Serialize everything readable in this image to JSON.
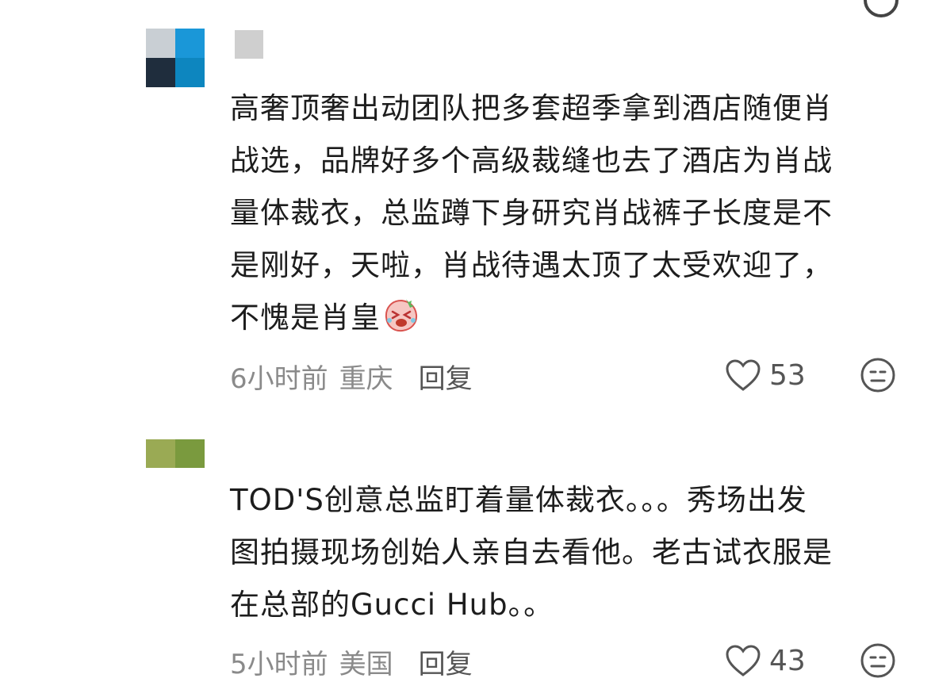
{
  "comments": [
    {
      "text_lines": [
        "高奢顶奢出动团队把多套超季拿到酒店随便肖",
        "战选，品牌好多个高级裁缝也去了酒店为肖战",
        "量体裁衣，总监蹲下身研究肖战裤子长度是不",
        "是刚好，天啦，肖战待遇太顶了太受欢迎了，",
        "不愧是肖皇"
      ],
      "emoji": "laughing-crying-emoji",
      "time": "6小时前",
      "location": "重庆",
      "reply_label": "回复",
      "likes": "53"
    },
    {
      "text_lines": [
        "TOD'S创意总监盯着量体裁衣。。。秀场出发",
        "图拍摄现场创始人亲自去看他。老古试衣服是",
        "在总部的Gucci Hub。。"
      ],
      "time": "5小时前",
      "location": "美国",
      "reply_label": "回复",
      "likes": "43"
    }
  ],
  "colors": {
    "text": "#1d1d1d",
    "meta": "#8a8a8a",
    "icon": "#555555"
  }
}
